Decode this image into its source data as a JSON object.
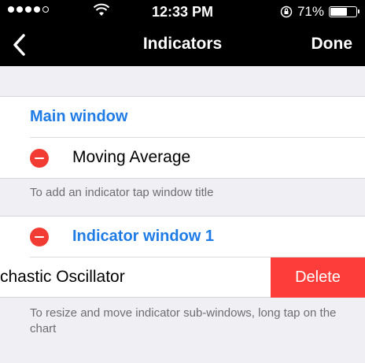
{
  "status_bar": {
    "time": "12:33 PM",
    "battery_percent": "71%",
    "battery_level": 0.71,
    "signal_bars_filled": 4,
    "signal_bars_total": 5
  },
  "nav": {
    "title": "Indicators",
    "done_label": "Done",
    "back_icon": "chevron-left-icon"
  },
  "main_section": {
    "header": "Main window",
    "items": [
      {
        "label": "Moving Average"
      }
    ],
    "footer": "To add an indicator tap window title"
  },
  "indicator_section": {
    "header": "Indicator window 1",
    "items": [
      {
        "label": "chastic Oscillator",
        "delete_label": "Delete"
      }
    ],
    "footer": "To resize and move indicator sub-windows, long tap on the chart"
  },
  "colors": {
    "accent": "#1f7ce6",
    "delete": "#fc3d39",
    "minus": "#f23c33",
    "background": "#efeff4"
  }
}
